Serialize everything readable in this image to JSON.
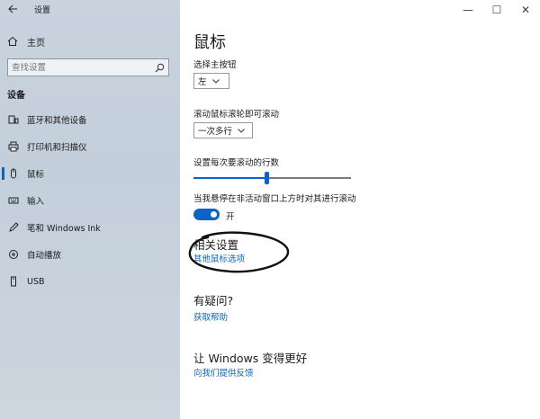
{
  "window": {
    "title": "设置",
    "controls": {
      "minimize": "—",
      "maximize": "☐",
      "close": "✕"
    }
  },
  "sidebar": {
    "home_label": "主页",
    "search_placeholder": "查找设置",
    "section_title": "设备",
    "items": [
      {
        "label": "蓝牙和其他设备",
        "icon": "devices-icon"
      },
      {
        "label": "打印机和扫描仪",
        "icon": "printer-icon"
      },
      {
        "label": "鼠标",
        "icon": "mouse-icon",
        "active": true
      },
      {
        "label": "输入",
        "icon": "keyboard-icon"
      },
      {
        "label": "笔和 Windows Ink",
        "icon": "pen-icon"
      },
      {
        "label": "自动播放",
        "icon": "autoplay-icon"
      },
      {
        "label": "USB",
        "icon": "usb-icon"
      }
    ]
  },
  "main": {
    "title": "鼠标",
    "primary_button": {
      "label": "选择主按钮",
      "value": "左"
    },
    "scroll_mode": {
      "label": "滚动鼠标滚轮即可滚动",
      "value": "一次多行"
    },
    "scroll_lines": {
      "label": "设置每次要滚动的行数",
      "fraction": 0.46
    },
    "inactive_scroll": {
      "label": "当我悬停在非活动窗口上方时对其进行滚动",
      "state": "开"
    },
    "related": {
      "heading": "相关设置",
      "link": "其他鼠标选项"
    },
    "questions": {
      "heading": "有疑问?",
      "link": "获取帮助"
    },
    "improve": {
      "heading": "让 Windows 变得更好",
      "link": "向我们提供反馈"
    }
  },
  "colors": {
    "accent": "#0a63c9",
    "sidebar_bg": "#c9d3de"
  }
}
